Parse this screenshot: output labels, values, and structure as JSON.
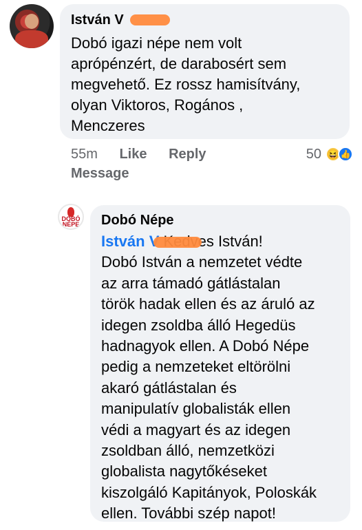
{
  "comment": {
    "author": "István V",
    "text_lines": [
      "Dobó igazi népe nem volt",
      "aprópénzért, de darabosért sem",
      "megvehető. Ez rossz hamisítvány,",
      "olyan Viktoros, Rogános ,",
      "Menczeres"
    ],
    "time": "55m",
    "like_label": "Like",
    "reply_label": "Reply",
    "message_label": "Message",
    "reaction_count": "50",
    "reaction_icons": [
      "haha-icon",
      "like-icon"
    ]
  },
  "reply": {
    "author": "Dobó Népe",
    "avatar_logo_text": "DOBÓ NÉPE",
    "mention": "István V",
    "first_line_rest": " Kedves István!",
    "text_lines": [
      "Dobó István a nemzetet védte",
      "az arra támadó gátlástalan",
      "török hadak ellen és az áruló az",
      "idegen zsoldba álló Hegedüs",
      "hadnagyok ellen. A Dobó Népe",
      "pedig a nemzeteket eltörölni",
      "akaró gátlástalan és",
      "manipulatív globalisták ellen",
      "védi a magyart és az idegen",
      "zsoldban álló, nemzetközi",
      "globalista nagytőkéseket",
      "kiszolgáló Kapitányok, Poloskák",
      "ellen. További szép napot!"
    ]
  },
  "colors": {
    "bubble": "#f0f2f5",
    "link": "#1877f2",
    "meta": "#65676b",
    "redaction": "#ff8a3d"
  }
}
